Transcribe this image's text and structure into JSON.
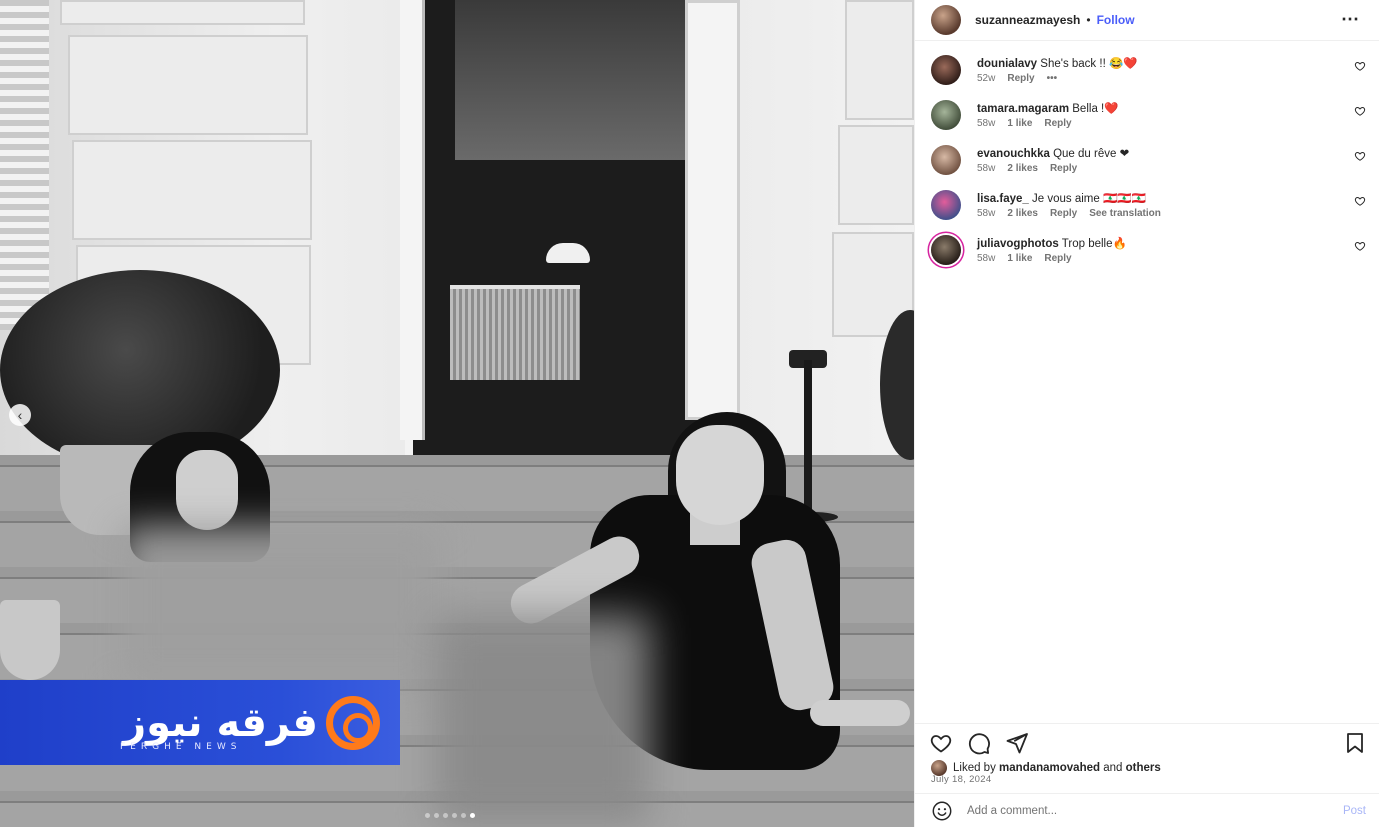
{
  "post": {
    "author": "suzanneazmayesh",
    "separator": "•",
    "follow_label": "Follow",
    "more_label": "⋯"
  },
  "media": {
    "watermark_text": "فرقه نيوز",
    "watermark_sub": "FERGHE NEWS",
    "carousel_count": 6,
    "carousel_active_index": 5
  },
  "comments": [
    {
      "user": "dounialavy",
      "text": "She's back !! 😂❤️",
      "time": "52w",
      "likes": "",
      "reply": "Reply",
      "extra": "•••"
    },
    {
      "user": "tamara.magaram",
      "text": "Bella !❤️",
      "time": "58w",
      "likes": "1 like",
      "reply": "Reply",
      "extra": ""
    },
    {
      "user": "evanouchkka",
      "text": "Que du rêve ❤",
      "time": "58w",
      "likes": "2 likes",
      "reply": "Reply",
      "extra": ""
    },
    {
      "user": "lisa.faye_",
      "text": "Je vous aime 🇱🇧🇱🇧🇱🇧",
      "time": "58w",
      "likes": "2 likes",
      "reply": "Reply",
      "extra": "See translation"
    },
    {
      "user": "juliavogphotos",
      "text": "Trop belle🔥",
      "time": "58w",
      "likes": "1 like",
      "reply": "Reply",
      "extra": ""
    }
  ],
  "engagement": {
    "liked_prefix": "Liked by",
    "liked_user": "mandanamovahed",
    "liked_and": "and",
    "liked_others": "others",
    "date": "July 18, 2024"
  },
  "composer": {
    "placeholder": "Add a comment...",
    "post_label": "Post"
  },
  "colors": {
    "follow": "#4a5df9",
    "post_disabled": "#a9b6f7",
    "watermark_bg": "#2a4fd8",
    "watermark_logo": "#ff7a1a"
  }
}
